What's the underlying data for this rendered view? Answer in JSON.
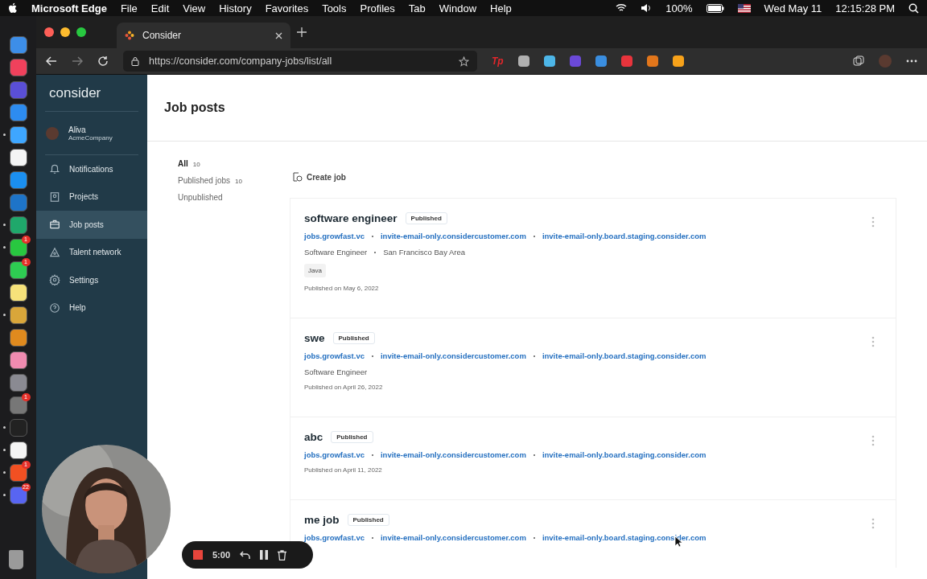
{
  "menu_bar": {
    "app": "Microsoft Edge",
    "menus": [
      "File",
      "Edit",
      "View",
      "History",
      "Favorites",
      "Tools",
      "Profiles",
      "Tab",
      "Window",
      "Help"
    ],
    "battery": "100%",
    "date": "Wed May 11",
    "time": "12:15:28 PM"
  },
  "dock": [
    {
      "running": false
    },
    {
      "running": false
    },
    {
      "running": false
    },
    {
      "running": false
    },
    {
      "running": true
    },
    {
      "running": false
    },
    {
      "running": false
    },
    {
      "running": false
    },
    {
      "running": true
    },
    {
      "running": true,
      "badge": "1"
    },
    {
      "running": false,
      "badge": "1"
    },
    {
      "running": false
    },
    {
      "running": true
    },
    {
      "running": false
    },
    {
      "running": false
    },
    {
      "running": false
    },
    {
      "running": false,
      "badge": "1"
    },
    {
      "running": true
    },
    {
      "running": true
    },
    {
      "running": true,
      "badge": "1"
    },
    {
      "running": true,
      "badge": "22"
    }
  ],
  "browser": {
    "tab_title": "Consider",
    "url": "https://consider.com/company-jobs/list/all",
    "extension_label": "Tp"
  },
  "sidebar": {
    "logo": "consider",
    "user": {
      "name": "Aliva",
      "company": "AcmeCompany"
    },
    "items": [
      {
        "label": "Notifications",
        "kind": "bell",
        "selected": false
      },
      {
        "label": "Projects",
        "kind": "board",
        "selected": false
      },
      {
        "label": "Job posts",
        "kind": "briefcase",
        "selected": true
      },
      {
        "label": "Talent network",
        "kind": "network",
        "selected": false
      },
      {
        "label": "Settings",
        "kind": "gear",
        "selected": false
      },
      {
        "label": "Help",
        "kind": "help",
        "selected": false
      }
    ]
  },
  "page": {
    "title": "Job posts",
    "filters": [
      {
        "label": "All",
        "count": "10",
        "selected": true
      },
      {
        "label": "Published jobs",
        "count": "10",
        "selected": false
      },
      {
        "label": "Unpublished",
        "selected": false
      }
    ],
    "create_button": "Create job"
  },
  "jobs": [
    {
      "title": "software engineer",
      "status": "Published",
      "links": [
        "jobs.growfast.vc",
        "invite-email-only.considercustomer.com",
        "invite-email-only.board.staging.consider.com"
      ],
      "meta": [
        "Software Engineer",
        "San Francisco Bay Area"
      ],
      "tags": [
        "Java"
      ],
      "published": "Published on May 6, 2022"
    },
    {
      "title": "swe",
      "status": "Published",
      "links": [
        "jobs.growfast.vc",
        "invite-email-only.considercustomer.com",
        "invite-email-only.board.staging.consider.com"
      ],
      "meta": [
        "Software Engineer"
      ],
      "published": "Published on April 26, 2022"
    },
    {
      "title": "abc",
      "status": "Published",
      "links": [
        "jobs.growfast.vc",
        "invite-email-only.considercustomer.com",
        "invite-email-only.board.staging.consider.com"
      ],
      "published": "Published on April 11, 2022"
    },
    {
      "title": "me job",
      "status": "Published",
      "links": [
        "jobs.growfast.vc",
        "invite-email-only.considercustomer.com",
        "invite-email-only.board.staging.consider.com"
      ]
    }
  ],
  "recorder": {
    "timer": "5:00"
  }
}
